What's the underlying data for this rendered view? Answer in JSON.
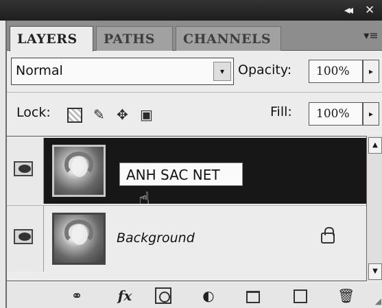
{
  "window": {
    "title_controls": [
      "◂◂",
      "✕"
    ],
    "tabs": [
      {
        "label": "LAYERS",
        "active": true
      },
      {
        "label": "PATHS",
        "active": false
      },
      {
        "label": "CHANNELS",
        "active": false
      }
    ]
  },
  "blend": {
    "mode": "Normal",
    "opacity_label": "Opacity:",
    "opacity_value": "100%"
  },
  "lock": {
    "label": "Lock:",
    "fill_label": "Fill:",
    "fill_value": "100%"
  },
  "layers": [
    {
      "name": "ANH SAC NET",
      "visible": true,
      "selected": true,
      "editing_name": true
    },
    {
      "name": "Background",
      "visible": true,
      "selected": false,
      "locked": true
    }
  ],
  "toolbar": {
    "link": "⚭",
    "fx": "fx",
    "adjust": "◐"
  },
  "colors": {
    "panel": "#ececec",
    "tabbar": "#8d8d8d",
    "selected_layer": "#171717"
  },
  "icons": [
    "panel-menu-icon",
    "eye-icon",
    "hand-cursor-icon",
    "lock-icon",
    "link-icon",
    "fx-icon",
    "mask-icon",
    "adjustment-icon",
    "group-icon",
    "new-layer-icon",
    "trash-icon"
  ]
}
